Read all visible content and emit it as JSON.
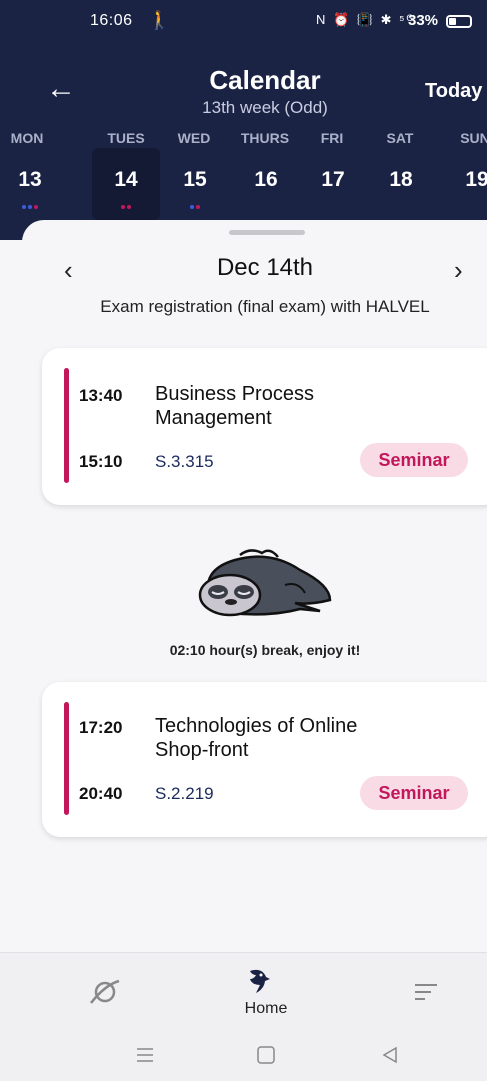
{
  "status_bar": {
    "time": "16:06",
    "walk_icon": "walking-person-icon",
    "icons_text": "N ⏰ 📳 ✱ ⁵ᴳ",
    "battery": "33%"
  },
  "header": {
    "back_icon": "arrow-left-icon",
    "title": "Calendar",
    "subtitle": "13th week (Odd)",
    "today_label": "Today"
  },
  "week": {
    "days": [
      {
        "name": "MON",
        "num": "13",
        "dots": [
          "#3b5bdb",
          "#3b5bdb",
          "#c2185b"
        ]
      },
      {
        "name": "TUES",
        "num": "14",
        "dots": [
          "#c2185b",
          "#c2185b"
        ],
        "selected": true
      },
      {
        "name": "WED",
        "num": "15",
        "dots": [
          "#3b5bdb",
          "#c2185b"
        ]
      },
      {
        "name": "THURS",
        "num": "16",
        "dots": []
      },
      {
        "name": "FRI",
        "num": "17",
        "dots": []
      },
      {
        "name": "SAT",
        "num": "18",
        "dots": []
      },
      {
        "name": "SUN",
        "num": "19",
        "dots": []
      }
    ]
  },
  "day_view": {
    "prev_icon": "chevron-left-icon",
    "next_icon": "chevron-right-icon",
    "date": "Dec 14th",
    "note": "Exam registration (final exam) with HALVEL"
  },
  "events": [
    {
      "start": "13:40",
      "end": "15:10",
      "title": "Business Process Management",
      "room": "S.3.315",
      "type": "Seminar"
    },
    {
      "start": "17:20",
      "end": "20:40",
      "title": "Technologies of Online Shop-front",
      "room": "S.2.219",
      "type": "Seminar"
    }
  ],
  "break": {
    "icon": "sleeping-sloth-icon",
    "text": "02:10 hour(s) break, enjoy it!"
  },
  "bottom_nav": {
    "explore_icon": "planet-icon",
    "home_icon": "bird-logo-icon",
    "home_label": "Home",
    "menu_icon": "menu-lines-icon"
  },
  "colors": {
    "header_bg": "#1b2345",
    "accent": "#c2185b",
    "badge_bg": "#f9dbe6",
    "blue_dot": "#3b5bdb"
  }
}
